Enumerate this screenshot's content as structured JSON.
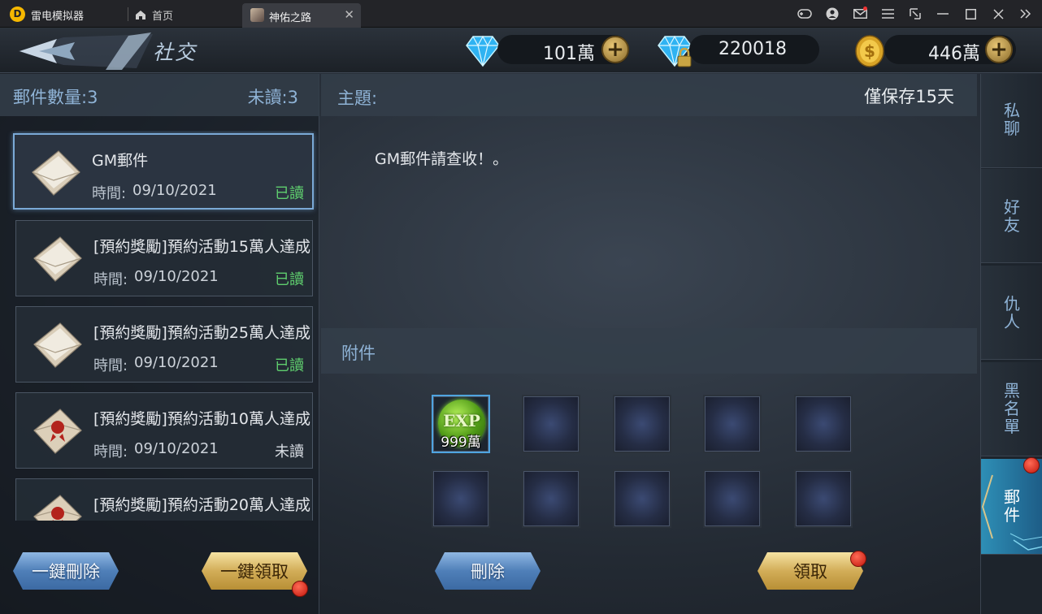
{
  "emulator": {
    "app_name": "雷电模拟器",
    "home_tab": "首页",
    "game_tab": "神佑之路",
    "tab_close": "✕"
  },
  "header": {
    "title": "社交",
    "currencies": [
      {
        "name": "diamond",
        "value": "101萬"
      },
      {
        "name": "bound-diamond",
        "value": "220018"
      },
      {
        "name": "gold",
        "value": "446萬"
      }
    ],
    "plus": "+"
  },
  "mail_panel": {
    "count_label": "郵件數量:3",
    "unread_label": "未讀:3",
    "time_label": "時間:",
    "mails": [
      {
        "title": "GM郵件",
        "date": "09/10/2021",
        "status": "已讀",
        "read": true
      },
      {
        "title": "[預約獎勵]預約活動15萬人達成",
        "date": "09/10/2021",
        "status": "已讀",
        "read": true
      },
      {
        "title": "[預約獎勵]預約活動25萬人達成",
        "date": "09/10/2021",
        "status": "已讀",
        "read": true
      },
      {
        "title": "[預約獎勵]預約活動10萬人達成",
        "date": "09/10/2021",
        "status": "未讀",
        "read": false
      },
      {
        "title": "[預約獎勵]預約活動20萬人達成",
        "date": "",
        "status": "",
        "read": false
      }
    ],
    "delete_all": "一鍵刪除",
    "claim_all": "一鍵領取"
  },
  "content": {
    "subject_label": "主題:",
    "keep_note": "僅保存15天",
    "body": "GM郵件請查收！。",
    "attach_label": "附件",
    "attachment": {
      "icon": "EXP",
      "qty": "999萬"
    },
    "delete": "刪除",
    "claim": "領取"
  },
  "side_tabs": [
    "私聊",
    "好友",
    "仇人",
    "黑名單",
    "郵件"
  ],
  "colors": {
    "read": "#5fce6e",
    "label_blue": "#8fb3d6",
    "active_tab": "#2e8fb6"
  }
}
